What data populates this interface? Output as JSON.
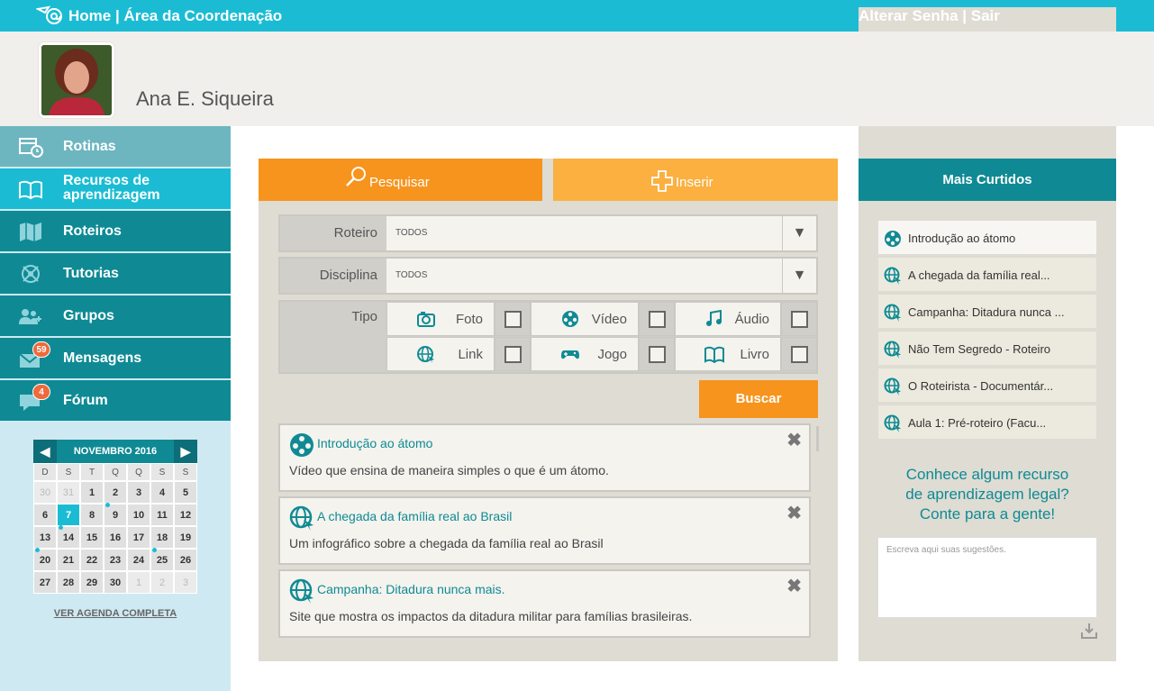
{
  "topbar": {
    "logo_icon": "at-mail-icon",
    "home_title": "Home | Área da Coordenação",
    "account_links": "Alterar Senha | Sair"
  },
  "profile": {
    "name": "Ana E. Siqueira"
  },
  "sidebar": {
    "items": [
      {
        "label": "Rotinas",
        "icon": "calendar-clock-icon",
        "active": false
      },
      {
        "label": "Recursos de aprendizagem",
        "icon": "book-icon",
        "active": true
      },
      {
        "label": "Roteiros",
        "icon": "map-icon",
        "active": false
      },
      {
        "label": "Tutorias",
        "icon": "compass-icon",
        "active": false
      },
      {
        "label": "Grupos",
        "icon": "group-icon",
        "active": false
      },
      {
        "label": "Mensagens",
        "icon": "envelope-icon",
        "badge": "59",
        "active": false
      },
      {
        "label": "Fórum",
        "icon": "chat-icon",
        "badge": "4",
        "active": false
      }
    ],
    "colors": {
      "nav": "#0f8a94",
      "nav_active": "#1bbcd3",
      "nav_first": "#6db6c0"
    }
  },
  "calendar": {
    "month": "NOVEMBRO 2016",
    "weekdays": [
      "D",
      "S",
      "T",
      "Q",
      "Q",
      "S",
      "S"
    ],
    "days": [
      {
        "d": "30",
        "dim": true
      },
      {
        "d": "31",
        "dim": true
      },
      {
        "d": "1"
      },
      {
        "d": "2"
      },
      {
        "d": "3"
      },
      {
        "d": "4"
      },
      {
        "d": "5"
      },
      {
        "d": "6"
      },
      {
        "d": "7",
        "today": true
      },
      {
        "d": "8"
      },
      {
        "d": "9",
        "dot": true
      },
      {
        "d": "10"
      },
      {
        "d": "11"
      },
      {
        "d": "12"
      },
      {
        "d": "13"
      },
      {
        "d": "14",
        "dot": true
      },
      {
        "d": "15"
      },
      {
        "d": "16"
      },
      {
        "d": "17"
      },
      {
        "d": "18"
      },
      {
        "d": "19"
      },
      {
        "d": "20",
        "dot": true
      },
      {
        "d": "21"
      },
      {
        "d": "22"
      },
      {
        "d": "23"
      },
      {
        "d": "24"
      },
      {
        "d": "25",
        "dot": true
      },
      {
        "d": "26"
      },
      {
        "d": "27"
      },
      {
        "d": "28"
      },
      {
        "d": "29"
      },
      {
        "d": "30"
      },
      {
        "d": "1",
        "dim": true
      },
      {
        "d": "2",
        "dim": true
      },
      {
        "d": "3",
        "dim": true
      }
    ],
    "full_link": "VER AGENDA COMPLETA"
  },
  "main": {
    "tab_search": "Pesquisar",
    "tab_insert": "Inserir",
    "roteiro_label": "Roteiro",
    "roteiro_value": "TODOS",
    "disciplina_label": "Disciplina",
    "disciplina_value": "TODOS",
    "tipo_label": "Tipo",
    "tipos": [
      {
        "label": "Foto",
        "icon": "camera-icon",
        "checked": false
      },
      {
        "label": "Vídeo",
        "icon": "film-reel-icon",
        "checked": false
      },
      {
        "label": "Áudio",
        "icon": "music-note-icon",
        "checked": false
      },
      {
        "label": "Link",
        "icon": "globe-cursor-icon",
        "checked": false
      },
      {
        "label": "Jogo",
        "icon": "gamepad-icon",
        "checked": false
      },
      {
        "label": "Livro",
        "icon": "book-icon",
        "checked": false
      }
    ],
    "search_button": "Buscar",
    "results": [
      {
        "title": "Introdução ao átomo",
        "desc": "Vídeo que ensina de maneira simples o que é um átomo.",
        "icon": "film-reel-icon"
      },
      {
        "title": "A chegada da família real ao Brasil",
        "desc": "Um infográfico sobre a chegada da família real ao Brasil",
        "icon": "globe-cursor-icon"
      },
      {
        "title": "Campanha: Ditadura nunca mais.",
        "desc": "Site que mostra os impactos da ditadura militar para famílias brasileiras.",
        "icon": "globe-cursor-icon"
      }
    ],
    "colors": {
      "search_tab": "#f7941d",
      "insert_tab": "#fbb040",
      "panel": "#dedcd3"
    }
  },
  "right": {
    "title": "Mais Curtidos",
    "items": [
      {
        "label": "Introdução ao átomo",
        "icon": "film-reel-icon"
      },
      {
        "label": "A chegada da família real...",
        "icon": "globe-cursor-icon"
      },
      {
        "label": "Campanha: Ditadura nunca ...",
        "icon": "globe-cursor-icon"
      },
      {
        "label": "Não Tem Segredo - Roteiro",
        "icon": "globe-cursor-icon"
      },
      {
        "label": "O Roteirista - Documentár...",
        "icon": "globe-cursor-icon"
      },
      {
        "label": "Aula 1: Pré-roteiro (Facu...",
        "icon": "globe-cursor-icon"
      }
    ],
    "suggestion_line1": "Conhece algum recurso",
    "suggestion_line2": "de aprendizagem legal?",
    "suggestion_line3": "Conte para a gente!",
    "suggestion_placeholder": "Escreva aqui suas sugestões.",
    "download_icon": "download-tray-icon"
  }
}
